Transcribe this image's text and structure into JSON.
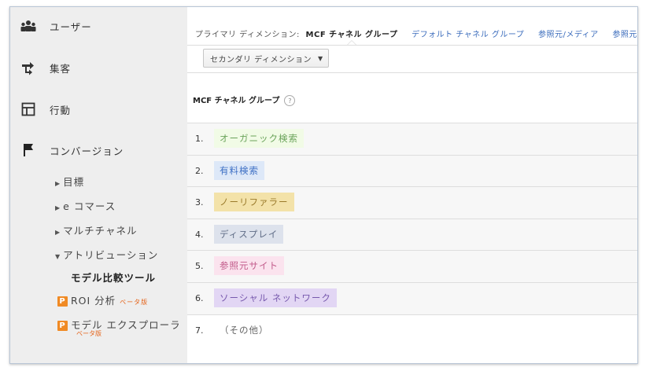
{
  "sidebar": {
    "items": [
      {
        "label": "ユーザー",
        "icon": "users-icon"
      },
      {
        "label": "集客",
        "icon": "acquisition-arrows-icon"
      },
      {
        "label": "行動",
        "icon": "behavior-layout-icon"
      },
      {
        "label": "コンバージョン",
        "icon": "flag-icon"
      }
    ],
    "sub": {
      "goals": "目標",
      "ecommerce": "e コマース",
      "multichannel": "マルチチャネル",
      "attribution": "アトリビューション",
      "model_compare": "モデル比較ツール",
      "roi": "ROI 分析",
      "roi_beta": "ベータ版",
      "explorer": "モデル エクスプローラ",
      "explorer_beta": "ベータ版",
      "badge": "P"
    }
  },
  "dimension_bar": {
    "label": "プライマリ ディメンション:",
    "active": "MCF チャネル グループ",
    "links": [
      "デフォルト チャネル グループ",
      "参照元/メディア",
      "参照元"
    ]
  },
  "secondary_dimension": {
    "label": "セカンダリ ディメンション",
    "arrow": "▼"
  },
  "table": {
    "header": "MCF チャネル グループ",
    "help": "?",
    "rows": [
      {
        "num": "1.",
        "label": "オーガニック検索",
        "bg": "#f1fbe6",
        "fg": "#6aa35a"
      },
      {
        "num": "2.",
        "label": "有料検索",
        "bg": "#dde8f8",
        "fg": "#3d6fc4"
      },
      {
        "num": "3.",
        "label": "ノーリファラー",
        "bg": "#f3e2a9",
        "fg": "#9a7a2a"
      },
      {
        "num": "4.",
        "label": "ディスプレイ",
        "bg": "#dde2ec",
        "fg": "#5f6c86"
      },
      {
        "num": "5.",
        "label": "参照元サイト",
        "bg": "#fbe3ee",
        "fg": "#c25a8a"
      },
      {
        "num": "6.",
        "label": "ソーシャル ネットワーク",
        "bg": "#e2d6f4",
        "fg": "#7759ad"
      },
      {
        "num": "7.",
        "label": "（その他）",
        "bg": "transparent",
        "fg": "#666666"
      }
    ]
  }
}
